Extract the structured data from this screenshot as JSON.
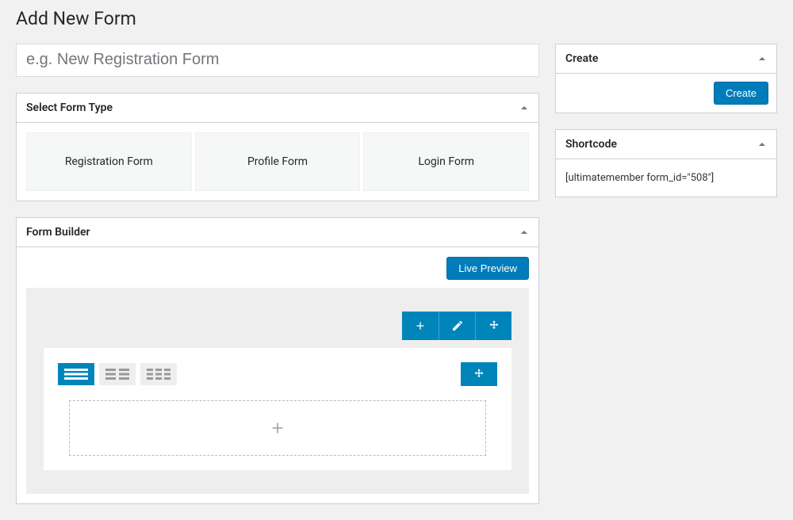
{
  "page": {
    "title": "Add New Form"
  },
  "form_name": {
    "placeholder": "e.g. New Registration Form",
    "value": ""
  },
  "panels": {
    "select_form_type": {
      "title": "Select Form Type"
    },
    "form_builder": {
      "title": "Form Builder"
    },
    "create": {
      "title": "Create",
      "button": "Create"
    },
    "shortcode": {
      "title": "Shortcode",
      "value": "[ultimatemember form_id=\"508\"]"
    }
  },
  "form_types": [
    {
      "label": "Registration Form"
    },
    {
      "label": "Profile Form"
    },
    {
      "label": "Login Form"
    }
  ],
  "builder": {
    "live_preview": "Live Preview"
  }
}
